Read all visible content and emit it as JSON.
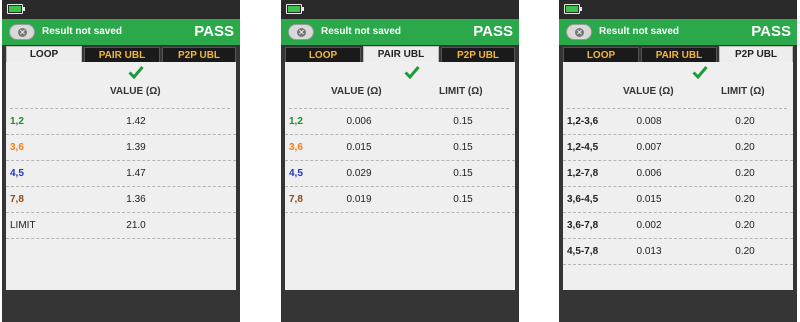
{
  "header": {
    "message": "Result not saved",
    "result": "PASS"
  },
  "tabs": [
    "LOOP",
    "PAIR UBL",
    "P2P UBL"
  ],
  "colors": {
    "accent_green": "#2aa84a",
    "tab_inactive_text": "#f0b73b",
    "pair_12": "#1f8a2e",
    "pair_36": "#f07d1a",
    "pair_45": "#1f35c8",
    "pair_78": "#8a4a1a"
  },
  "screen1": {
    "active_tab": "LOOP",
    "col_value": "VALUE (Ω)",
    "rows": [
      {
        "label": "1,2",
        "value": "1.42"
      },
      {
        "label": "3,6",
        "value": "1.39"
      },
      {
        "label": "4,5",
        "value": "1.47"
      },
      {
        "label": "7,8",
        "value": "1.36"
      },
      {
        "label": "LIMIT",
        "value": "21.0"
      }
    ]
  },
  "screen2": {
    "active_tab": "PAIR UBL",
    "col_value": "VALUE (Ω)",
    "col_limit": "LIMIT (Ω)",
    "rows": [
      {
        "label": "1,2",
        "value": "0.006",
        "limit": "0.15"
      },
      {
        "label": "3,6",
        "value": "0.015",
        "limit": "0.15"
      },
      {
        "label": "4,5",
        "value": "0.029",
        "limit": "0.15"
      },
      {
        "label": "7,8",
        "value": "0.019",
        "limit": "0.15"
      }
    ]
  },
  "screen3": {
    "active_tab": "P2P UBL",
    "col_value": "VALUE (Ω)",
    "col_limit": "LIMIT (Ω)",
    "rows": [
      {
        "label": "1,2-3,6",
        "value": "0.008",
        "limit": "0.20"
      },
      {
        "label": "1,2-4,5",
        "value": "0.007",
        "limit": "0.20"
      },
      {
        "label": "1,2-7,8",
        "value": "0.006",
        "limit": "0.20"
      },
      {
        "label": "3,6-4,5",
        "value": "0.015",
        "limit": "0.20"
      },
      {
        "label": "3,6-7,8",
        "value": "0.002",
        "limit": "0.20"
      },
      {
        "label": "4,5-7,8",
        "value": "0.013",
        "limit": "0.20"
      }
    ]
  }
}
